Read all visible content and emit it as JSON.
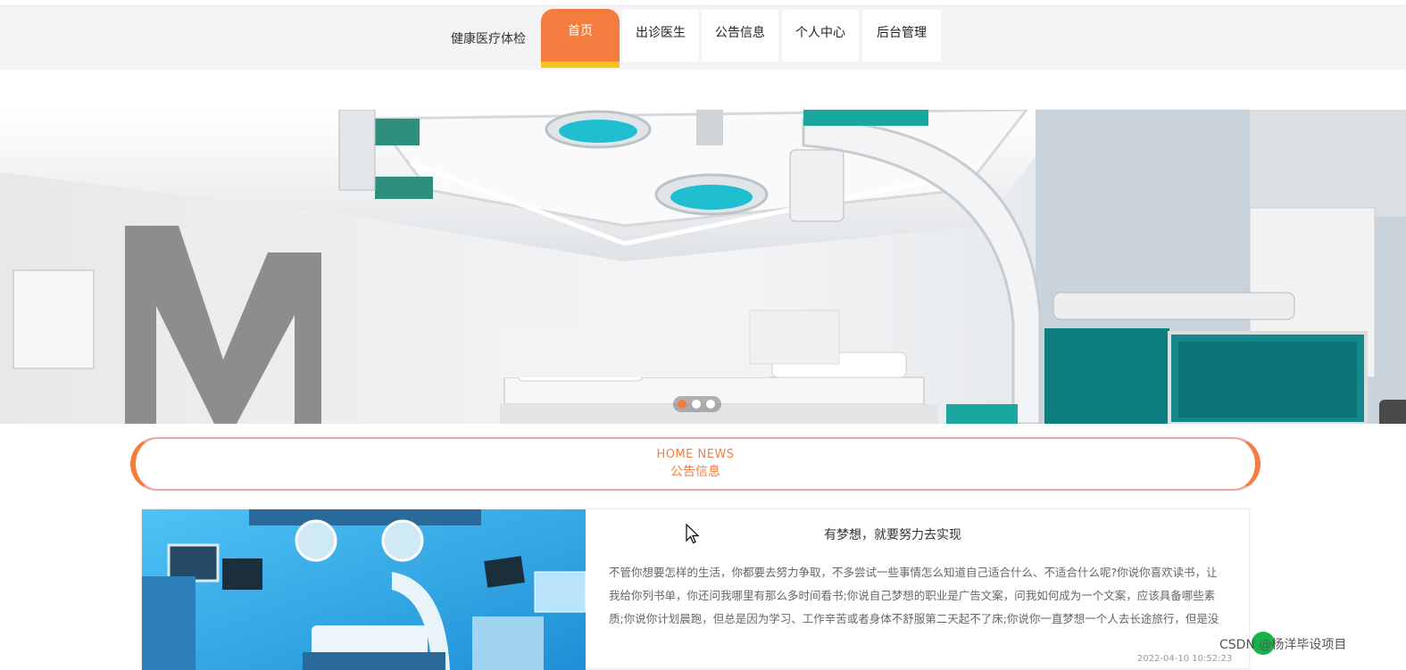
{
  "nav": {
    "brand": "健康医疗体检",
    "items": [
      {
        "label": "首页",
        "active": true
      },
      {
        "label": "出诊医生",
        "active": false
      },
      {
        "label": "公告信息",
        "active": false
      },
      {
        "label": "个人中心",
        "active": false
      },
      {
        "label": "后台管理",
        "active": false
      }
    ]
  },
  "banner": {
    "slide_count": 3,
    "active_slide": 1,
    "arrow_icon": "chevron-left-icon"
  },
  "section": {
    "title_en": "HOME NEWS",
    "title_cn": "公告信息"
  },
  "news": {
    "title": "有梦想，就要努力去实现",
    "body": "不管你想要怎样的生活，你都要去努力争取，不多尝试一些事情怎么知道自己适合什么、不适合什么呢?你说你喜欢读书，让我给你列书单，你还问我哪里有那么多时间看书;你说自己梦想的职业是广告文案，问我如何成为一个文案，应该具备哪些素质;你说你计划晨跑，但总是因为学习、工作辛苦或者身体不舒服第二天起不了床;你说你一直梦想一个人去长途旅行，但是没钱，...",
    "date": "2022-04-10 10:52:23"
  },
  "watermark": "CSDN @杨洋毕设项目",
  "colors": {
    "accent": "#f57c3f",
    "accent_underline": "#f7c51a",
    "border_pink": "#f2a4a4"
  }
}
